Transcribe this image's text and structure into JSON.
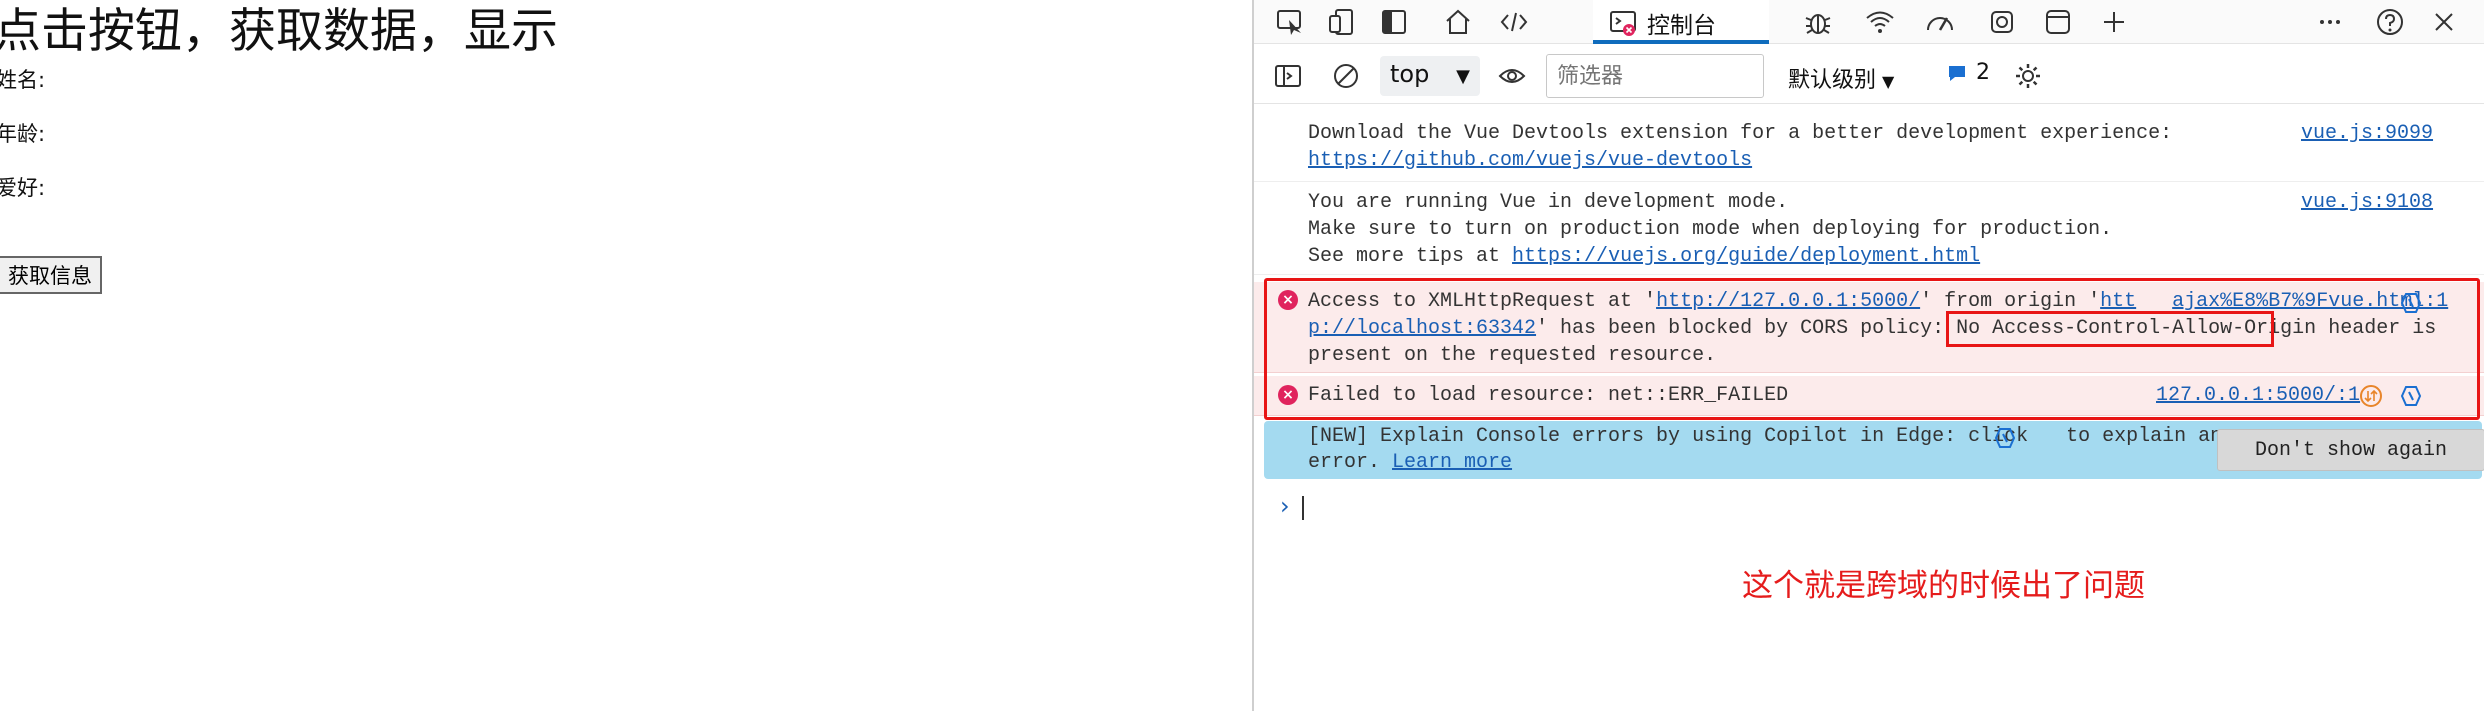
{
  "page": {
    "title": "点击按钮，获取数据，显示",
    "fields": [
      {
        "label": "姓名:"
      },
      {
        "label": "年龄:"
      },
      {
        "label": "爱好:"
      }
    ],
    "button_label": "获取信息"
  },
  "devtools": {
    "tabs": {
      "console_label": "控制台",
      "icons": [
        "inspect-icon",
        "device-emulation-icon",
        "dock-icon",
        "home-icon",
        "elements-icon",
        "console-icon",
        "sources-bug-icon",
        "network-wifi-icon",
        "performance-icon",
        "settings-gear-icon",
        "application-icon",
        "add-tab-icon",
        "more-icon",
        "help-icon",
        "close-icon"
      ]
    },
    "toolbar": {
      "context": "top",
      "filter_placeholder": "筛选器",
      "level": "默认级别",
      "message_count": "2"
    },
    "messages": [
      {
        "type": "info",
        "lines": [
          "Download the Vue Devtools extension for a better development experience:"
        ],
        "link": "https://github.com/vuejs/vue-devtools",
        "source": "vue.js:9099"
      },
      {
        "type": "info",
        "lines": [
          "You are running Vue in development mode.",
          "Make sure to turn on production mode when deploying for production."
        ],
        "tips_prefix": "See more tips at ",
        "link": "https://vuejs.org/guide/deployment.html",
        "source": "vue.js:9108"
      },
      {
        "type": "error",
        "text_a": "Access to XMLHttpRequest at '",
        "url": "http://127.0.0.1:5000/",
        "text_b": "' from origin '",
        "origin_a": "htt",
        "origin_src": "ajax%E8%B7%9Fvue.html:1",
        "origin_b": "p://localhost:63342",
        "text_c": "' has been blocked by CORS policy: No ",
        "header": "Access-Control-Allow-Origin",
        "text_d": " header is",
        "text_e": "present on the requested resource."
      },
      {
        "type": "error",
        "text": "Failed to load resource: net::ERR_FAILED",
        "source": "127.0.0.1:5000/:1"
      }
    ],
    "copilot_banner": {
      "text_a": "[NEW] Explain Console errors by using Copilot in Edge: click",
      "text_b": " to explain an",
      "text_c": "error. ",
      "learn_more": "Learn more",
      "dismiss": "Don't show again"
    },
    "prompt_symbol": "›"
  },
  "annotation": "这个就是跨域的时候出了问题",
  "colors": {
    "error_bg": "#fcebeb",
    "highlight_red": "#e81515",
    "annotation_red": "#e51c1c",
    "banner_bg": "#a4daf0",
    "accent_blue": "#0f6cbd",
    "link_blue": "#1a5fb4"
  }
}
